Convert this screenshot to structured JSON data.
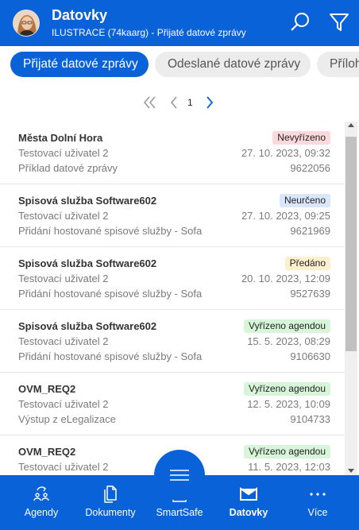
{
  "header": {
    "title": "Datovky",
    "subtitle": "ILUSTRACE (74kaarg) - Přijaté datové zprávy",
    "search_icon": "search-icon",
    "filter_icon": "filter-icon"
  },
  "tabs": [
    {
      "label": "Přijaté datové zprávy",
      "active": true
    },
    {
      "label": "Odeslané datové zprávy",
      "active": false
    },
    {
      "label": "Příloh",
      "active": false
    }
  ],
  "pager": {
    "current_page": "1"
  },
  "messages": [
    {
      "sender": "Města Dolní Hora",
      "user": "Testovací uživatel 2",
      "subject": "Příklad datové zprávy",
      "status": "Nevyřízeno",
      "status_color": "#fbd9dc",
      "date": "27. 10. 2023, 09:32",
      "id": "9622056"
    },
    {
      "sender": "Spisová služba Software602",
      "user": "Testovací uživatel 2",
      "subject": "Přidání hostované spisové služby - Sofa",
      "status": "Neurčeno",
      "status_color": "#d9e6fb",
      "date": "27. 10. 2023, 09:25",
      "id": "9621969"
    },
    {
      "sender": "Spisová služba Software602",
      "user": "Testovací uživatel 2",
      "subject": "Přidání hostované spisové služby - Sofa",
      "status": "Předáno",
      "status_color": "#fdf0cf",
      "date": "20. 10. 2023, 12:09",
      "id": "9527639"
    },
    {
      "sender": "Spisová služba Software602",
      "user": "Testovací uživatel 2",
      "subject": "Přidání hostované spisové služby - Sofa",
      "status": "Vyřízeno agendou",
      "status_color": "#d7f5d9",
      "date": "15. 5. 2023, 08:29",
      "id": "9106630"
    },
    {
      "sender": "OVM_REQ2",
      "user": "Testovací uživatel 2",
      "subject": "Výstup z eLegalizace",
      "status": "Vyřízeno agendou",
      "status_color": "#d7f5d9",
      "date": "12. 5. 2023, 10:09",
      "id": "9104733"
    },
    {
      "sender": "OVM_REQ2",
      "user": "Testovací uživatel 2",
      "subject": "",
      "status": "Vyřízeno agendou",
      "status_color": "#d7f5d9",
      "date": "11. 5. 2023, 12:03",
      "id": ""
    }
  ],
  "bottom_nav": [
    {
      "label": "Agendy",
      "icon": "agendy-icon",
      "active": false
    },
    {
      "label": "Dokumenty",
      "icon": "documents-icon",
      "active": false
    },
    {
      "label": "SmartSafe",
      "icon": "archive-box-icon",
      "active": false
    },
    {
      "label": "Datovky",
      "icon": "datovky-icon",
      "active": true
    },
    {
      "label": "Více",
      "icon": "more-icon",
      "active": false
    }
  ],
  "colors": {
    "brand": "#0a62d8"
  }
}
